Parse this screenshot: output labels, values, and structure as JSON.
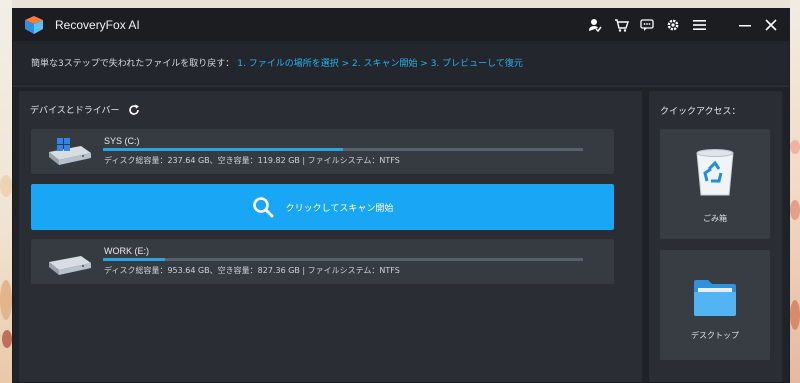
{
  "app": {
    "title": "RecoveryFox AI"
  },
  "banner": {
    "intro": "簡単な3ステップで失われたファイルを取り戻す：",
    "steps": "1. ファイルの場所を選択 > 2. スキャン開始 > 3. プレビューして復元"
  },
  "devices": {
    "title": "デバイスとドライバー",
    "drives": [
      {
        "name": "SYS (C:)",
        "info": "ディスク総容量：237.64 GB、空き容量：119.82 GB | ファイルシステム：NTFS",
        "used_fraction": 0.5
      },
      {
        "name": "WORK (E:)",
        "info": "ディスク総容量：953.64 GB、空き容量：827.36 GB | ファイルシステム：NTFS",
        "used_fraction": 0.13
      }
    ]
  },
  "scan": {
    "label": "クリックしてスキャン開始"
  },
  "quick_access": {
    "title": "クイックアクセス：",
    "items": [
      {
        "label": "ごみ箱",
        "icon": "recycle-bin-icon"
      },
      {
        "label": "デスクトップ",
        "icon": "folder-icon"
      }
    ]
  },
  "colors": {
    "accent": "#19a6f4",
    "steps_text": "#27b3f0"
  }
}
